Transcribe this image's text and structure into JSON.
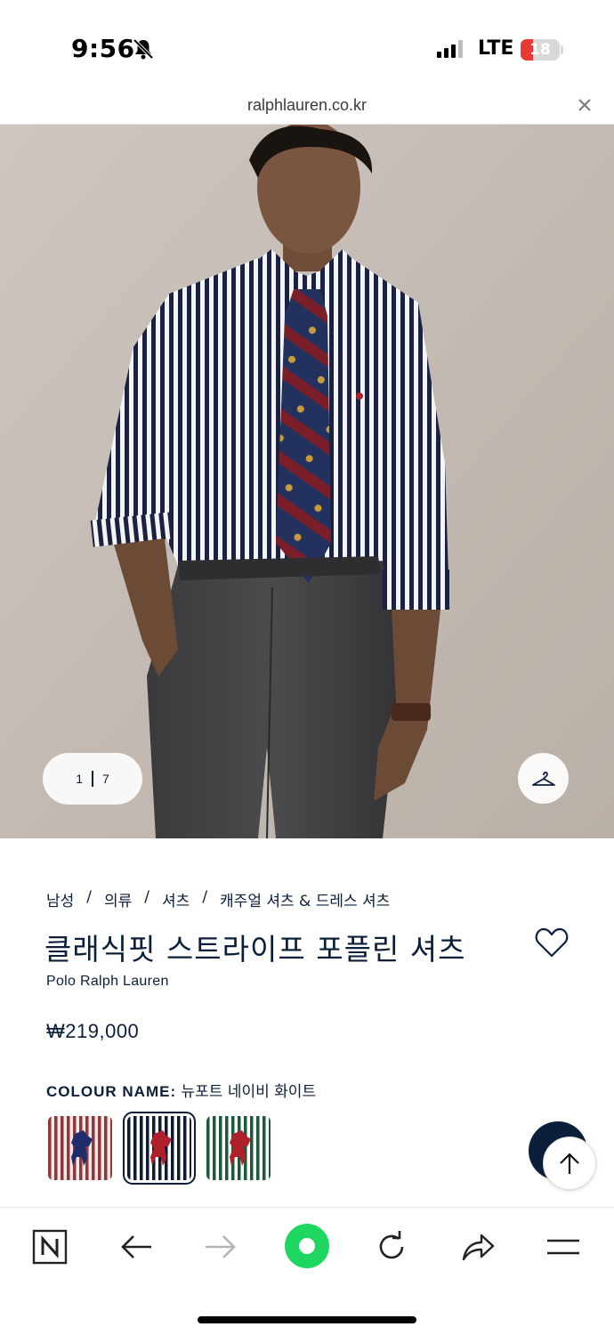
{
  "status_bar": {
    "time": "9:56",
    "network": "LTE",
    "battery": "18",
    "battery_level_percent": 18
  },
  "browser": {
    "url": "ralphlauren.co.kr"
  },
  "gallery": {
    "current": "1",
    "total": "7"
  },
  "breadcrumb": [
    "남성",
    "의류",
    "셔츠",
    "캐주얼 셔츠 & 드레스 셔츠"
  ],
  "product": {
    "title": "클래식핏 스트라이프 포플린 셔츠",
    "brand": "Polo Ralph Lauren",
    "price": "₩219,000",
    "colour_label": "COLOUR NAME:",
    "colour_value": "뉴포트 네이비 화이트"
  },
  "swatches": [
    {
      "name": "red-white-stripe",
      "stripe": "#8a3a3a",
      "bg": "#f2e6e6",
      "logo": "#1f2c6b",
      "selected": false
    },
    {
      "name": "navy-white-stripe",
      "stripe": "#0f1a35",
      "bg": "#ffffff",
      "logo": "#b0202a",
      "selected": true
    },
    {
      "name": "green-white-stripe",
      "stripe": "#1e5a3a",
      "bg": "#ffffff",
      "logo": "#b0202a",
      "selected": false
    }
  ],
  "colors": {
    "navy": "#0b1f3a",
    "toolbar_green": "#1ed760"
  },
  "toolbar": {
    "icons": [
      "naver-n-icon",
      "back-arrow-icon",
      "forward-arrow-icon",
      "home-green-icon",
      "refresh-icon",
      "share-icon",
      "menu-icon"
    ]
  }
}
